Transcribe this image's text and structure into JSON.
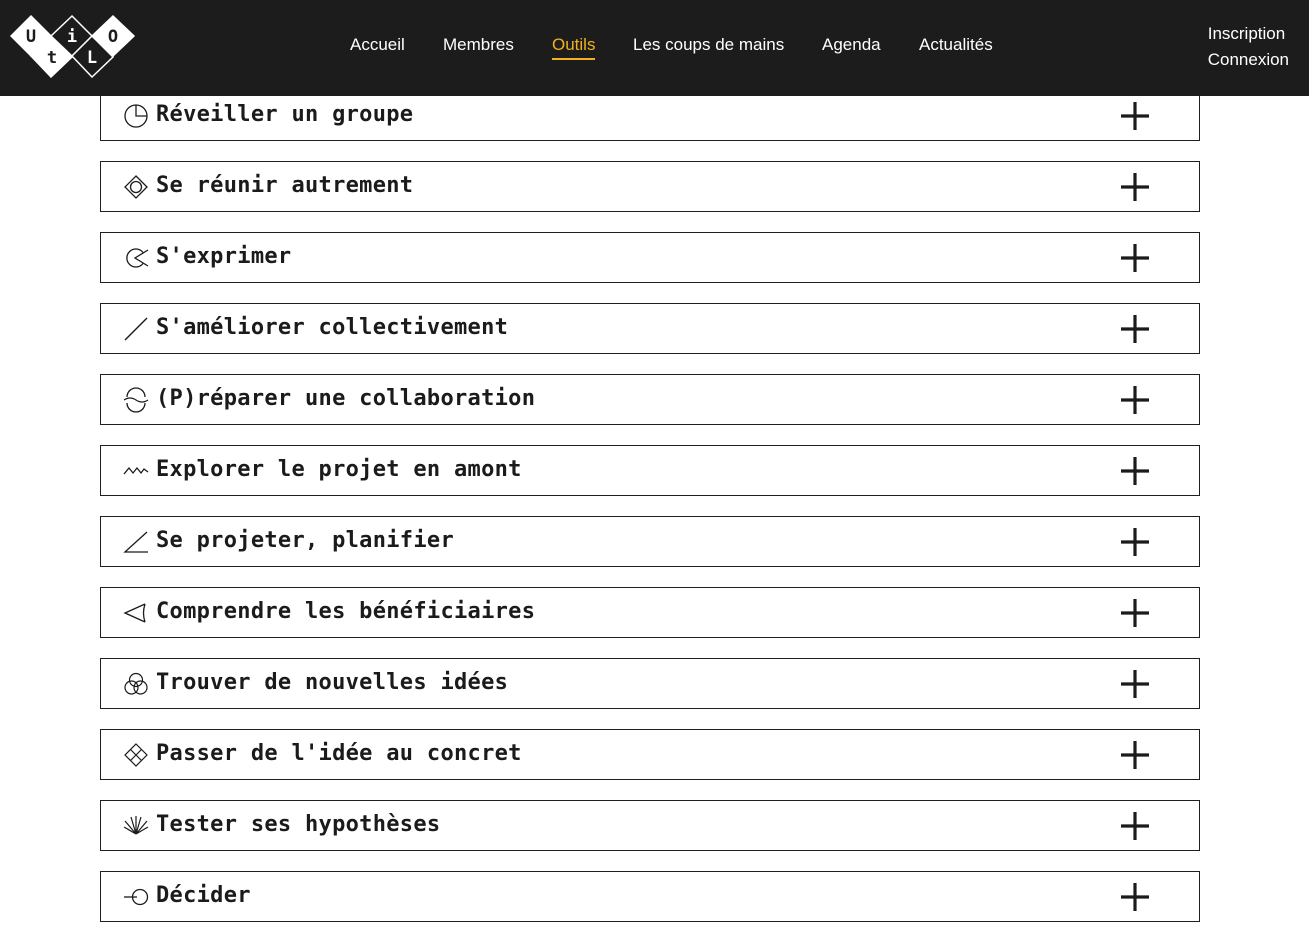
{
  "logo": {
    "letters": [
      "U",
      "t",
      "i",
      "L",
      "O"
    ]
  },
  "nav": {
    "items": [
      {
        "label": "Accueil",
        "active": false
      },
      {
        "label": "Membres",
        "active": false
      },
      {
        "label": "Outils",
        "active": true
      },
      {
        "label": "Les coups de mains",
        "active": false
      },
      {
        "label": "Agenda",
        "active": false
      },
      {
        "label": "Actualités",
        "active": false
      }
    ],
    "active_color": "#f2b01e"
  },
  "account": {
    "signup": "Inscription",
    "login": "Connexion"
  },
  "categories": [
    {
      "label": "Réveiller un groupe",
      "icon": "pie-clock-icon"
    },
    {
      "label": "Se réunir autrement",
      "icon": "diamond-circle-icon"
    },
    {
      "label": "S'exprimer",
      "icon": "circle-arrow-icon"
    },
    {
      "label": "S'améliorer collectivement",
      "icon": "diagonal-line-icon"
    },
    {
      "label": "(P)réparer une collaboration",
      "icon": "wave-circle-icon"
    },
    {
      "label": "Explorer le projet en amont",
      "icon": "zigzag-icon"
    },
    {
      "label": "Se projeter, planifier",
      "icon": "angle-icon"
    },
    {
      "label": "Comprendre les bénéficiaires",
      "icon": "cone-icon"
    },
    {
      "label": "Trouver de nouvelles idées",
      "icon": "venn-icon"
    },
    {
      "label": "Passer de l'idée au concret",
      "icon": "diamond-grid-icon"
    },
    {
      "label": "Tester ses hypothèses",
      "icon": "rays-icon"
    },
    {
      "label": "Décider",
      "icon": "line-circle-icon"
    }
  ],
  "colors": {
    "header_bg": "#1c1c1c",
    "border": "#1f1f1f",
    "text": "#1b1b1b"
  }
}
